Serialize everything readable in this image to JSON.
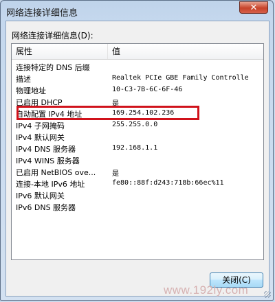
{
  "window": {
    "title": "网络连接详细信息",
    "close_glyph": "✕"
  },
  "group_label": "网络连接详细信息(D):",
  "columns": [
    "属性",
    "值"
  ],
  "rows": [
    {
      "prop": "连接特定的 DNS 后缀",
      "val": ""
    },
    {
      "prop": "描述",
      "val": "Realtek PCIe GBE Family Controlle"
    },
    {
      "prop": "物理地址",
      "val": "10-C3-7B-6C-6F-46"
    },
    {
      "prop": "已启用 DHCP",
      "val": "是"
    },
    {
      "prop": "自动配置 IPv4 地址",
      "val": "169.254.102.236"
    },
    {
      "prop": "IPv4 子网掩码",
      "val": "255.255.0.0"
    },
    {
      "prop": "IPv4 默认网关",
      "val": ""
    },
    {
      "prop": "IPv4 DNS 服务器",
      "val": "192.168.1.1"
    },
    {
      "prop": "IPv4 WINS 服务器",
      "val": ""
    },
    {
      "prop": "已启用 NetBIOS ove...",
      "val": "是"
    },
    {
      "prop": "连接-本地 IPv6 地址",
      "val": "fe80::88f:d243:718b:66ec%11"
    },
    {
      "prop": "IPv6 默认网关",
      "val": ""
    },
    {
      "prop": "IPv6 DNS 服务器",
      "val": ""
    }
  ],
  "highlight_color": "#d0121b",
  "close_button": "关闭(C)",
  "watermark": "www.192ly.com"
}
